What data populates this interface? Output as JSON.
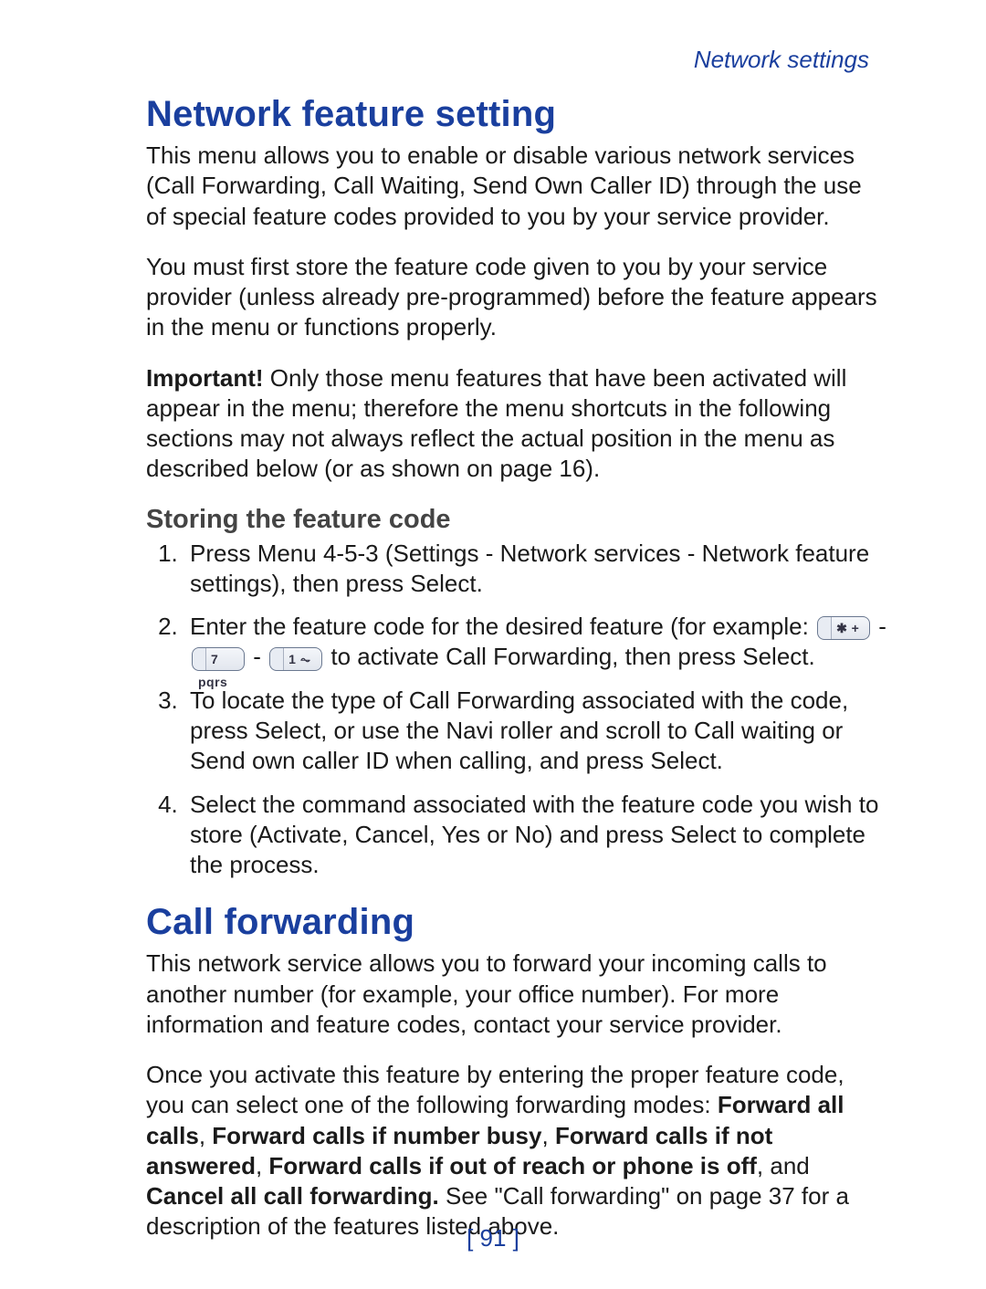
{
  "header": {
    "breadcrumb": "Network settings"
  },
  "section1": {
    "title": "Network feature setting",
    "p1": "This menu allows you to enable or disable various network services (Call Forwarding, Call Waiting, Send Own Caller ID) through the use of special feature codes provided to you by your service provider.",
    "p2": "You must first store the feature code given to you by your service provider (unless already pre-programmed) before the feature appears in the menu or functions properly.",
    "p3_bold": "Important!",
    "p3_rest": "  Only those menu features that have been activated will appear in the menu; therefore the menu shortcuts in the following sections may not always reflect the actual position in the menu as described below (or as shown on page 16).",
    "subhead": "Storing the feature code",
    "steps": {
      "s1_a": "Press ",
      "s1_b": "Menu 4-5-3",
      "s1_c": " (",
      "s1_d": "Settings",
      "s1_e": " - ",
      "s1_f": "Network services",
      "s1_g": " - ",
      "s1_h": "Network feature settings",
      "s1_i": "), then press ",
      "s1_j": "Select",
      "s1_k": ".",
      "s2_a": "Enter the feature code for the desired feature (for example:  ",
      "s2_keys": {
        "star": "✱ +",
        "seven": "7 pqrs",
        "one": "1 ⏦"
      },
      "s2_b": "  to activate Call Forwarding, then press ",
      "s2_c": "Select",
      "s2_d": ".",
      "s3_a": "To locate the type of Call Forwarding associated with the code, press ",
      "s3_b": "Select,",
      "s3_c": " or use the Navi roller and scroll to ",
      "s3_d": "Call waiting",
      "s3_e": " or ",
      "s3_f": "Send own caller ID when calling",
      "s3_g": ", and press ",
      "s3_h": "Select",
      "s3_i": ".",
      "s4_a": "Select the command associated with the feature code you wish to store (",
      "s4_b": "Activate",
      "s4_c": ", ",
      "s4_d": "Cancel",
      "s4_e": ", ",
      "s4_f": "Yes",
      "s4_g": " or ",
      "s4_h": "No",
      "s4_i": ") and press ",
      "s4_j": "Select",
      "s4_k": " to complete the process."
    }
  },
  "section2": {
    "title": "Call forwarding",
    "p1": "This network service allows you to forward your incoming calls to another number (for example, your office number). For more information and feature codes, contact your service provider.",
    "p2_a": "Once you activate this feature by entering the proper feature code, you can select one of the following forwarding modes: ",
    "p2_b": "Forward all calls",
    "p2_c": ", ",
    "p2_d": "Forward calls if number busy",
    "p2_e": ", ",
    "p2_f": "Forward calls if not answered",
    "p2_g": ", ",
    "p2_h": "Forward calls if out of reach or phone is off",
    "p2_i": ", and ",
    "p2_j": "Cancel all call forwarding.",
    "p2_k": " See \"Call forwarding\" on page 37 for a description of the features listed above."
  },
  "footer": {
    "page_number": "[ 91 ]"
  }
}
